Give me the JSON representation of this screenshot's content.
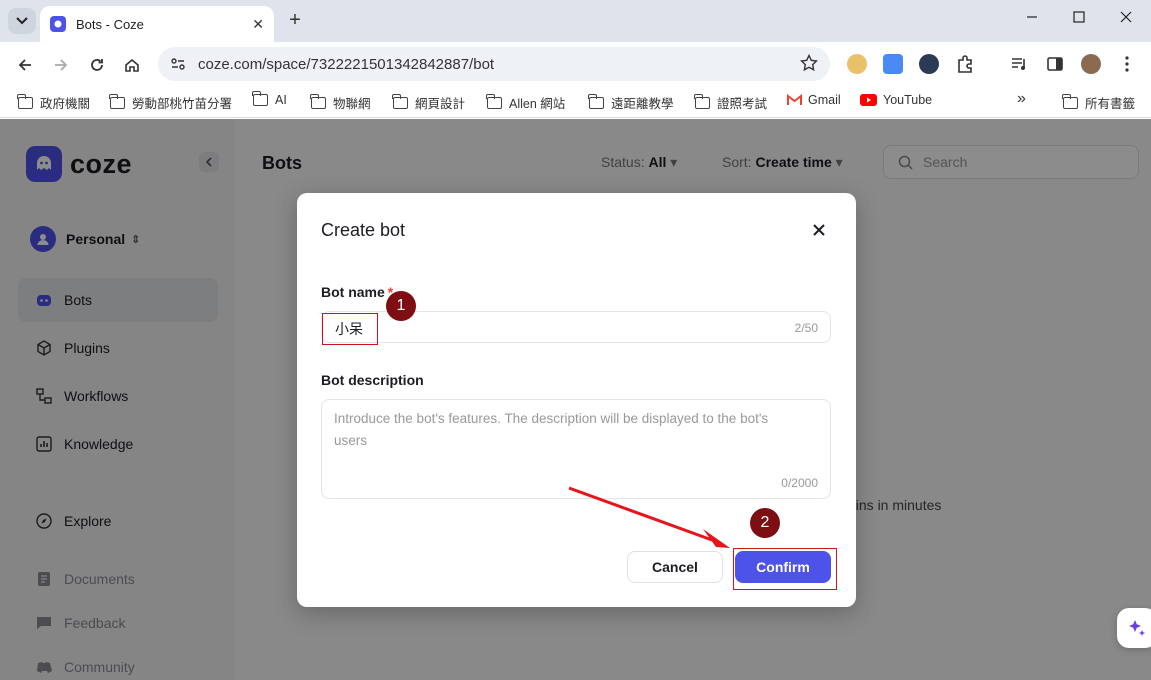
{
  "browser": {
    "tab_title": "Bots - Coze",
    "url": "coze.com/space/7322221501342842887/bot",
    "bookmarks": [
      "政府機關",
      "勞動部桃竹苗分署",
      "AI",
      "物聯網",
      "網頁設計",
      "Allen 網站",
      "遠距離教學",
      "證照考試",
      "Gmail",
      "YouTube"
    ],
    "bookmarks_overflow": "»",
    "other_bookmarks": "所有書籤"
  },
  "app": {
    "logo_text": "coze",
    "workspace": "Personal",
    "nav": [
      "Bots",
      "Plugins",
      "Workflows",
      "Knowledge",
      "Explore",
      "Documents",
      "Feedback",
      "Community"
    ]
  },
  "main": {
    "title": "Bots",
    "status_label": "Status:",
    "status_value": "All",
    "sort_label": "Sort:",
    "sort_value": "Create time",
    "search_placeholder": "Search",
    "background_text": "gins in minutes"
  },
  "dialog": {
    "title": "Create bot",
    "name_label": "Bot name",
    "required_mark": "*",
    "name_value": "小呆",
    "name_count": "2/50",
    "description_label": "Bot description",
    "description_placeholder": "Introduce the bot's features. The description will be displayed to the bot's users",
    "description_count": "0/2000",
    "cancel_label": "Cancel",
    "confirm_label": "Confirm"
  },
  "annotations": {
    "step1": "1",
    "step2": "2"
  },
  "colors": {
    "brand": "#4d53e8",
    "annotation_red": "#d0161c",
    "marker": "#7d0f12"
  }
}
